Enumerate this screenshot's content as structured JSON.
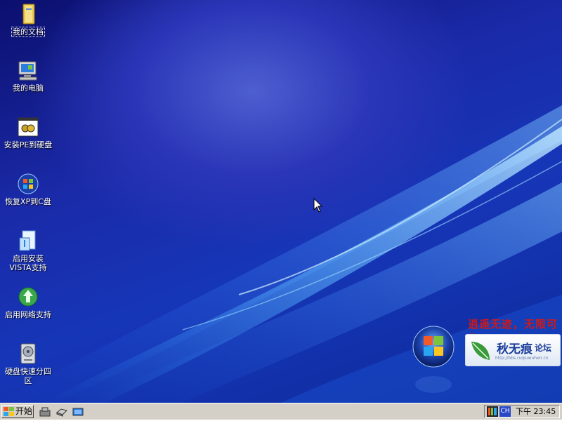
{
  "desktop": {
    "icons": [
      {
        "label": "我的文档"
      },
      {
        "label": "我的电脑"
      },
      {
        "label": "安装PE到硬盘"
      },
      {
        "label": "恢复XP到C盘"
      },
      {
        "label": "启用安装\nVISTA支持"
      },
      {
        "label": "启用网络支持"
      },
      {
        "label": "硬盘快速分四\n区"
      }
    ],
    "watermark": {
      "slogan": "逍遥无迹，无限可能",
      "logo_name": "秋无痕",
      "logo_suffix": "论坛",
      "logo_url": "http://bbs.ruqiuwuhen.cn"
    }
  },
  "taskbar": {
    "start_label": "开始",
    "lang_label": "CH",
    "clock": "下午 23:45"
  },
  "colors": {
    "taskbar_bg": "#d4d0c8",
    "desktop_blue": "#1636b8",
    "slogan_red": "#d01818"
  }
}
